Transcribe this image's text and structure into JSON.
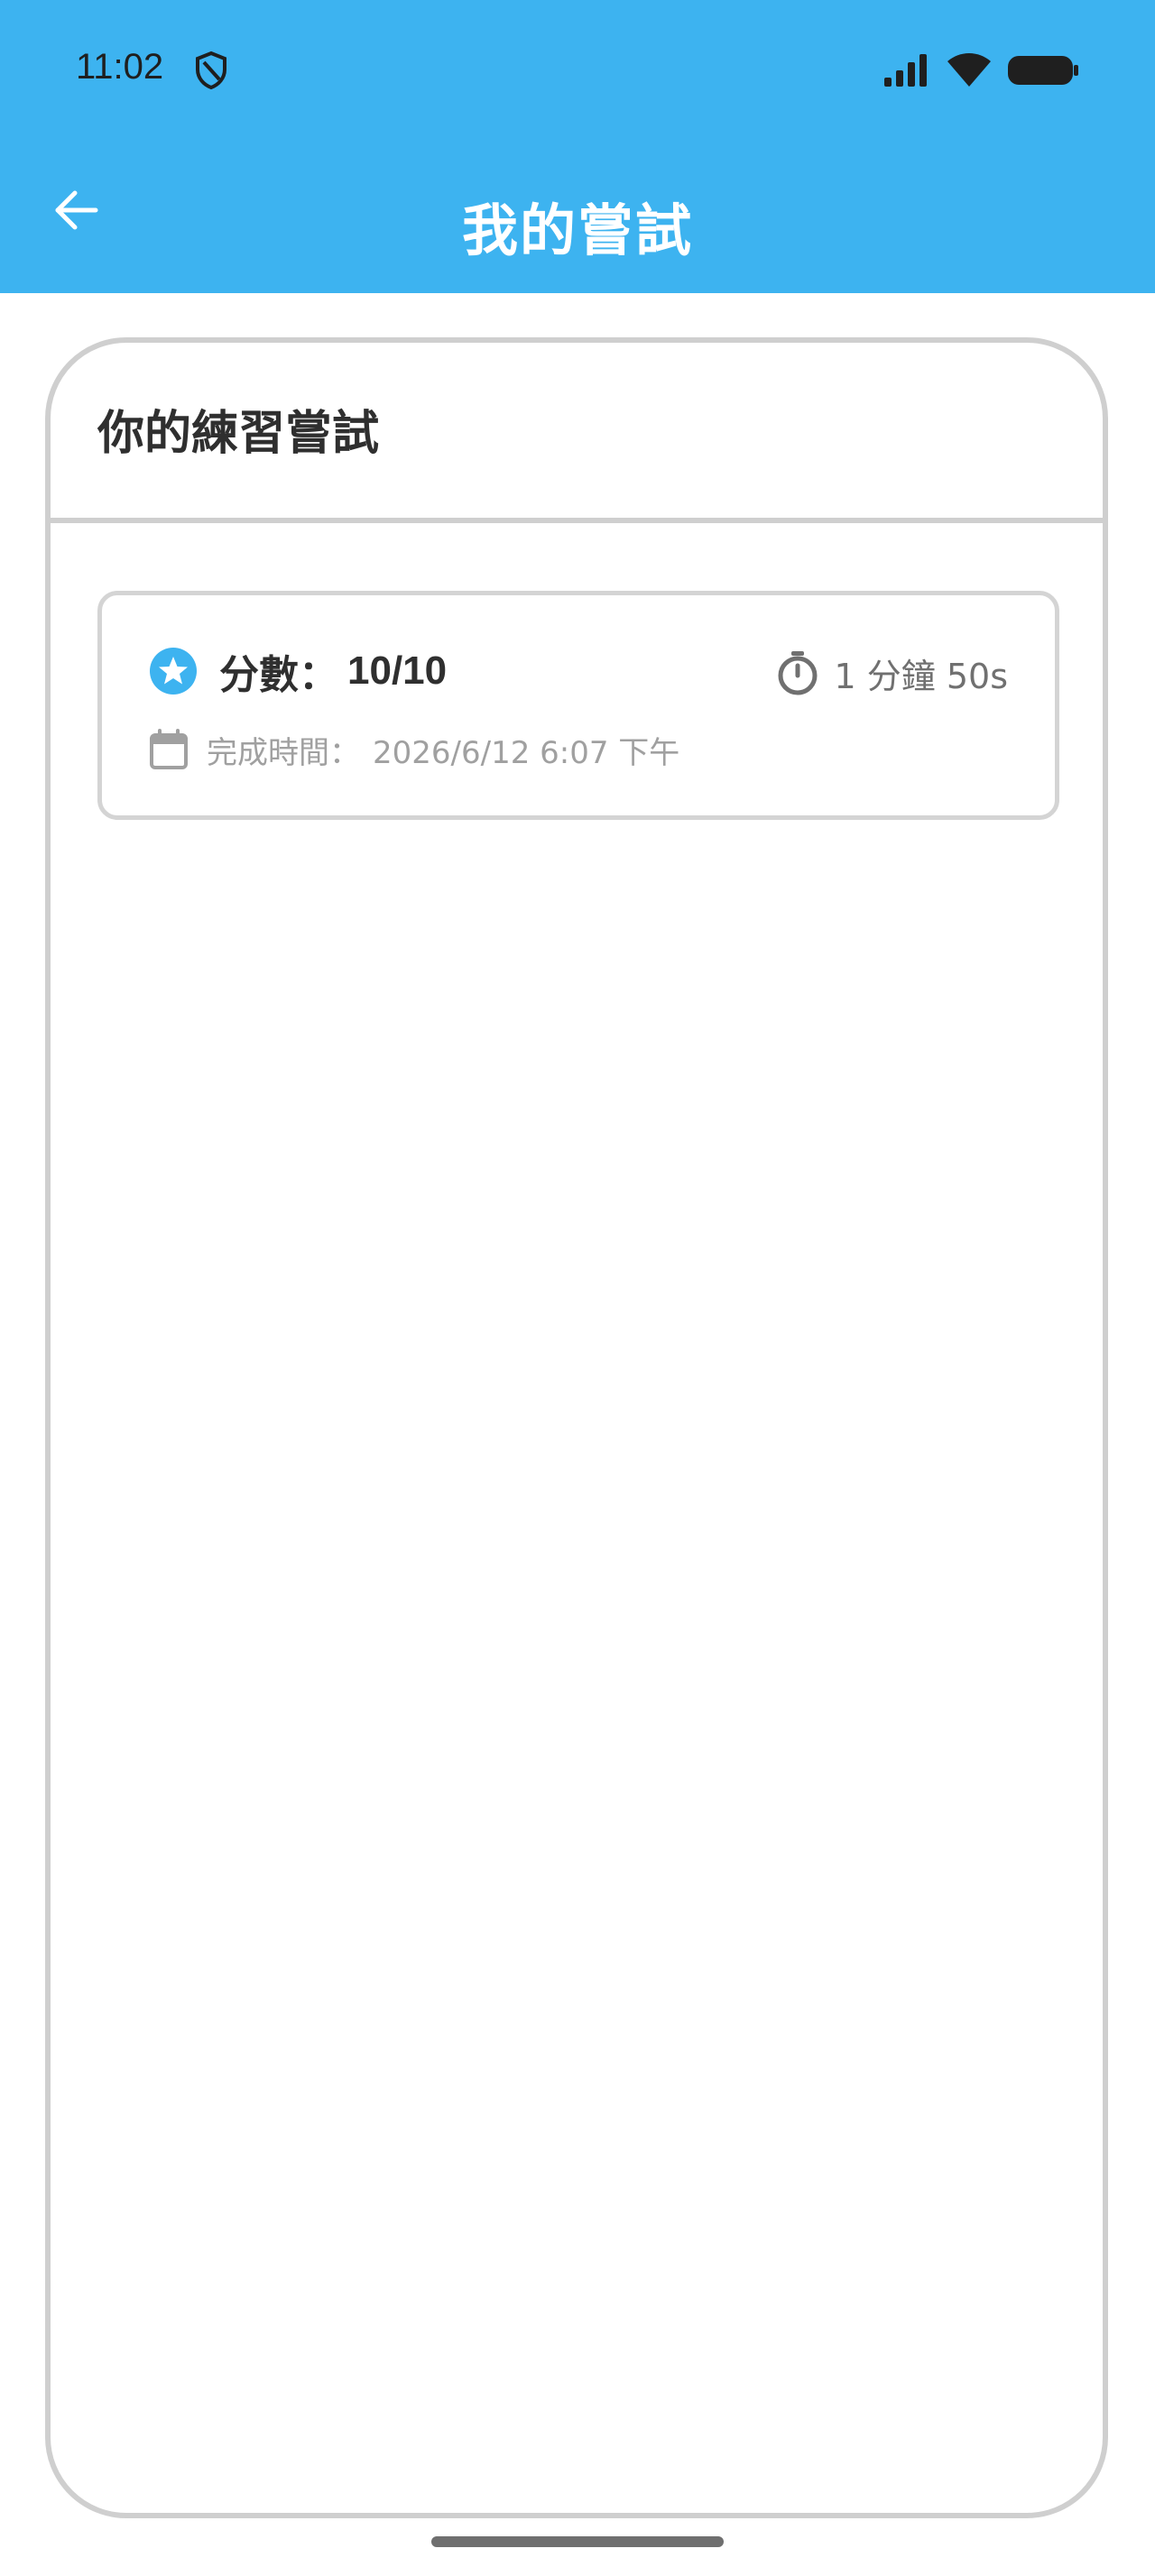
{
  "status_bar": {
    "time": "11:02",
    "icons": [
      "shield-icon",
      "signal-icon",
      "wifi-icon",
      "battery-icon"
    ]
  },
  "app_bar": {
    "title": "我的嘗試",
    "back_icon": "arrow-left-icon"
  },
  "section": {
    "title": "你的練習嘗試"
  },
  "attempts": [
    {
      "score_label": "分數：",
      "score_value": "10/10",
      "duration": "1 分鐘 50s",
      "completed_label": "完成時間：",
      "completed_value": "2026/6/12 6:07 下午"
    }
  ],
  "colors": {
    "primary": "#3db3f0",
    "border": "#cfcfcf",
    "text_dark": "#2f2f2f",
    "text_muted": "#a0a0a0"
  }
}
